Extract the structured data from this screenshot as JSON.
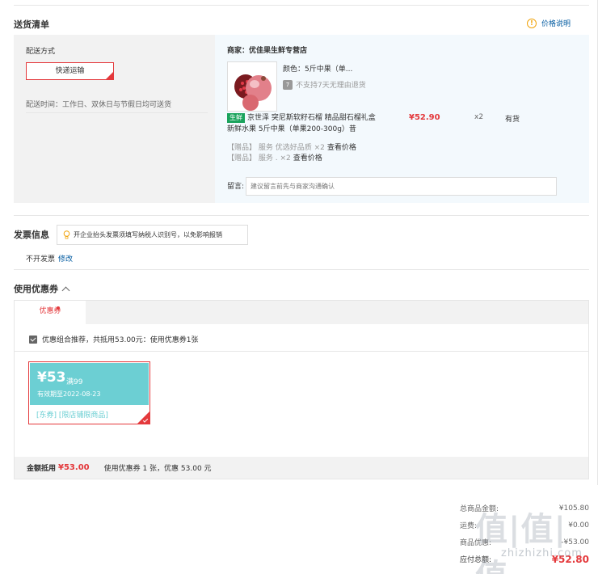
{
  "delivery": {
    "title": "送货清单",
    "price_help": "价格说明",
    "method_label": "配送方式",
    "method_value": "快递运输",
    "delivery_time": "配送时间：工作日、双休日与节假日均可送货"
  },
  "product": {
    "merchant": "商家：优佳果生鲜专营店",
    "color": "颜色：5斤中果（单...",
    "no_return": "不支持7天无理由退货",
    "seven_badge": "7",
    "fresh_tag": "生鲜",
    "name": "京世泽 突尼斯软籽石榴 精品甜石榴礼盒新鲜水果 5斤中果（单果200-300g）昔",
    "price": "¥52.90",
    "qty": "x2",
    "stock": "有货",
    "gifts": [
      {
        "text": "【赠品】 服务 优选好品质 ×2",
        "view": "查看价格"
      },
      {
        "text": "【赠品】 服务 . ×2",
        "view": "查看价格"
      }
    ],
    "note_label": "留言:",
    "note_placeholder": "建议留言前先与商家沟通确认"
  },
  "invoice": {
    "title": "发票信息",
    "tip": "开企业抬头发票须填写纳税人识别号，以免影响报销",
    "status": "不开发票",
    "modify": "修改"
  },
  "coupons": {
    "title": "使用优惠券",
    "tab": "优惠券",
    "combo_text": "优惠组合推荐，共抵用53.00元：使用优惠券1张",
    "card": {
      "amount": "¥53",
      "min": "满99",
      "expiry": "有效期至2022-08-23",
      "scope": "[东券] [限店铺限商品]"
    },
    "footer_label": "金额抵用",
    "footer_amount": "¥53.00",
    "footer_text": "使用优惠券 1 张，优惠 53.00 元"
  },
  "summary": {
    "rows": [
      {
        "k": "总商品金额:",
        "v": "¥105.80"
      },
      {
        "k": "运费:",
        "v": "¥0.00"
      },
      {
        "k": "商品优惠:",
        "v": "-¥53.00"
      }
    ],
    "total_label": "应付总额:",
    "total_value": "¥52.80"
  },
  "watermark": {
    "main": "值|值|值",
    "sub": "zhizhizhi.com"
  },
  "colors": {
    "accent_red": "#e4393c",
    "link_blue": "#005aa0",
    "coupon_teal": "#6ccfd3",
    "fresh_green": "#1aa35c"
  }
}
